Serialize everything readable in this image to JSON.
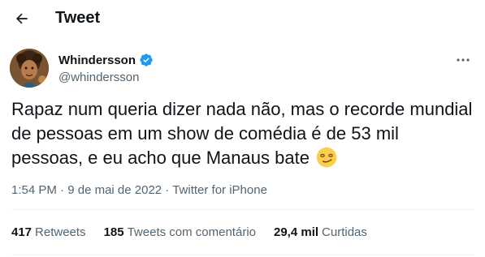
{
  "header": {
    "title": "Tweet",
    "back_icon": "arrow-left-icon"
  },
  "author": {
    "name": "Whindersson",
    "handle": "@whindersson",
    "verified": true,
    "verified_color": "#1d9bf0"
  },
  "tweet": {
    "text": "Rapaz num queria dizer nada não, mas o recorde mundial de pessoas em um show de comédia é de 53 mil pessoas, e eu acho que Manaus bate",
    "emoji": "smirking-face-emoji"
  },
  "meta": {
    "time": "1:54 PM",
    "separator1": " · ",
    "date": "9 de mai de 2022",
    "separator2": " · ",
    "source": "Twitter for iPhone"
  },
  "stats": {
    "retweets": {
      "count": "417",
      "label": "Retweets"
    },
    "quotes": {
      "count": "185",
      "label": "Tweets com comentário"
    },
    "likes": {
      "count": "29,4 mil",
      "label": "Curtidas"
    }
  }
}
